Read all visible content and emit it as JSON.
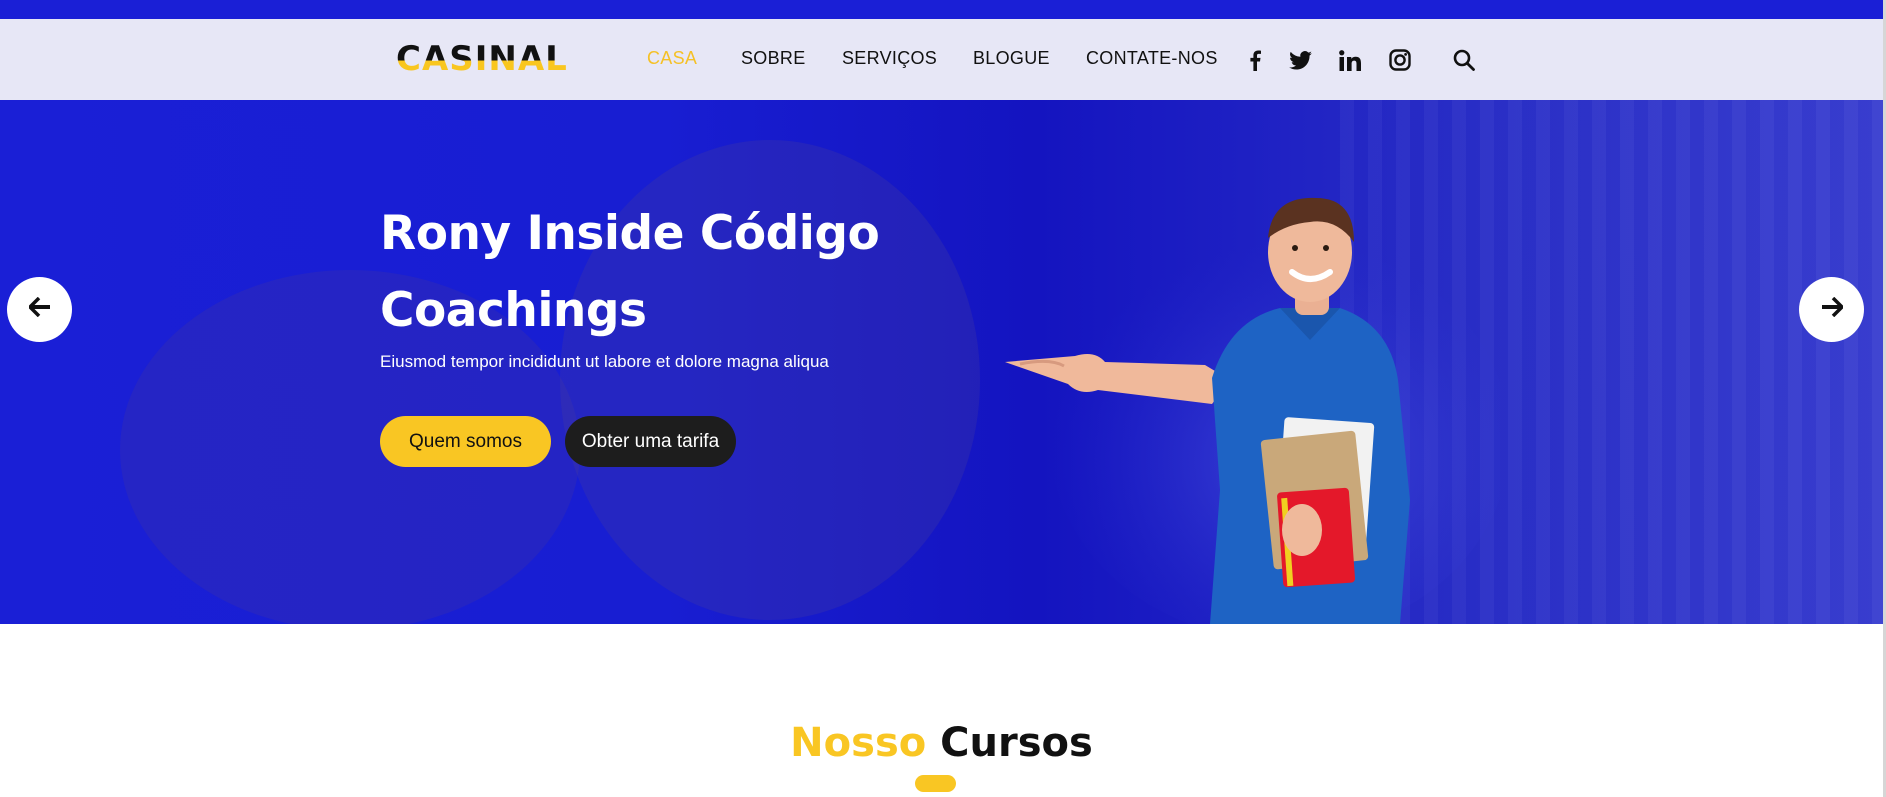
{
  "brand": {
    "logo_text": "CASINAL"
  },
  "nav": {
    "items": [
      {
        "label": "CASA",
        "active": true
      },
      {
        "label": "SOBRE",
        "active": false
      },
      {
        "label": "SERVIÇOS",
        "active": false
      },
      {
        "label": "BLOGUE",
        "active": false
      },
      {
        "label": "CONTATE-NOS",
        "active": false
      }
    ],
    "social_icons": [
      "facebook-icon",
      "twitter-icon",
      "linkedin-icon",
      "instagram-icon"
    ],
    "search_icon": "search-icon"
  },
  "hero": {
    "title_line1": "Rony Inside Código",
    "title_line2": "Coachings",
    "subtitle": "Eiusmod tempor incididunt ut labore et dolore magna aliqua",
    "primary_button": "Quem somos",
    "secondary_button": "Obter uma tarifa",
    "prev_icon": "arrow-left-icon",
    "next_icon": "arrow-right-icon"
  },
  "courses": {
    "title_highlight": "Nosso",
    "title_rest": "Cursos"
  },
  "colors": {
    "accent": "#f9c623",
    "hero_blue": "#1a1fd6",
    "navbar_bg": "#e7e7f6",
    "dark_button": "#1d1d1d"
  }
}
